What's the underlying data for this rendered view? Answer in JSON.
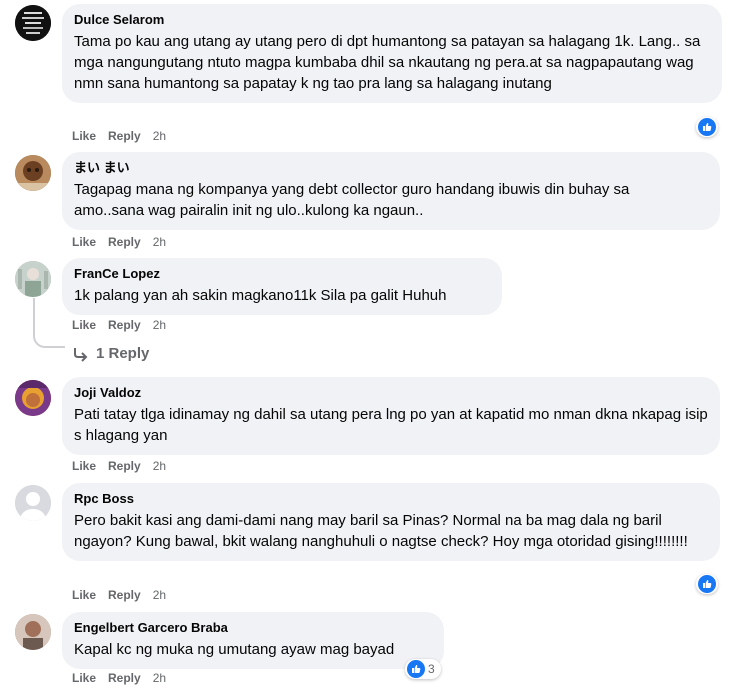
{
  "comments": [
    {
      "author": "Dulce Selarom",
      "text": "Tama po kau ang utang ay utang pero di dpt humantong sa patayan sa halagang 1k. Lang.. sa mga nangungutang ntuto magpa kumbaba dhil sa nkautang ng pera.at sa nagpapautang wag nmn sana humantong sa papatay k ng tao pra lang sa halagang inutang",
      "like": "Like",
      "reply": "Reply",
      "time": "2h",
      "reaction": "like-icon",
      "reaction_count": ""
    },
    {
      "author": "まい まい",
      "text": "Tagapag mana ng kompanya yang debt collector guro handang ibuwis din buhay sa amo..sana wag pairalin init ng ulo..kulong ka ngaun..",
      "like": "Like",
      "reply": "Reply",
      "time": "2h"
    },
    {
      "author": "FranCe Lopez",
      "text": "1k palang yan ah sakin magkano11k Sila pa galit Huhuh",
      "like": "Like",
      "reply": "Reply",
      "time": "2h",
      "replies_label": "1 Reply"
    },
    {
      "author": "Joji Valdoz",
      "text": "Pati tatay tlga idinamay ng dahil sa utang pera lng po yan at kapatid mo nman dkna nkapag isip s hlagang yan",
      "like": "Like",
      "reply": "Reply",
      "time": "2h"
    },
    {
      "author": "Rpc Boss",
      "text": "Pero bakit kasi ang dami-dami nang may baril sa Pinas? Normal na ba mag dala ng baril ngayon? Kung bawal, bkit walang nanghuhuli o nagtse check? Hoy mga otoridad gising!!!!!!!!",
      "like": "Like",
      "reply": "Reply",
      "time": "2h",
      "reaction": "like-icon",
      "reaction_count": ""
    },
    {
      "author": "Engelbert Garcero Braba",
      "text": "Kapal kc ng muka ng umutang ayaw mag bayad",
      "like": "Like",
      "reply": "Reply",
      "time": "2h",
      "reaction": "like-icon",
      "reaction_count": "3"
    }
  ],
  "colors": {
    "accent": "#1877f2",
    "bubble": "#f0f2f5",
    "meta": "#65676b"
  }
}
